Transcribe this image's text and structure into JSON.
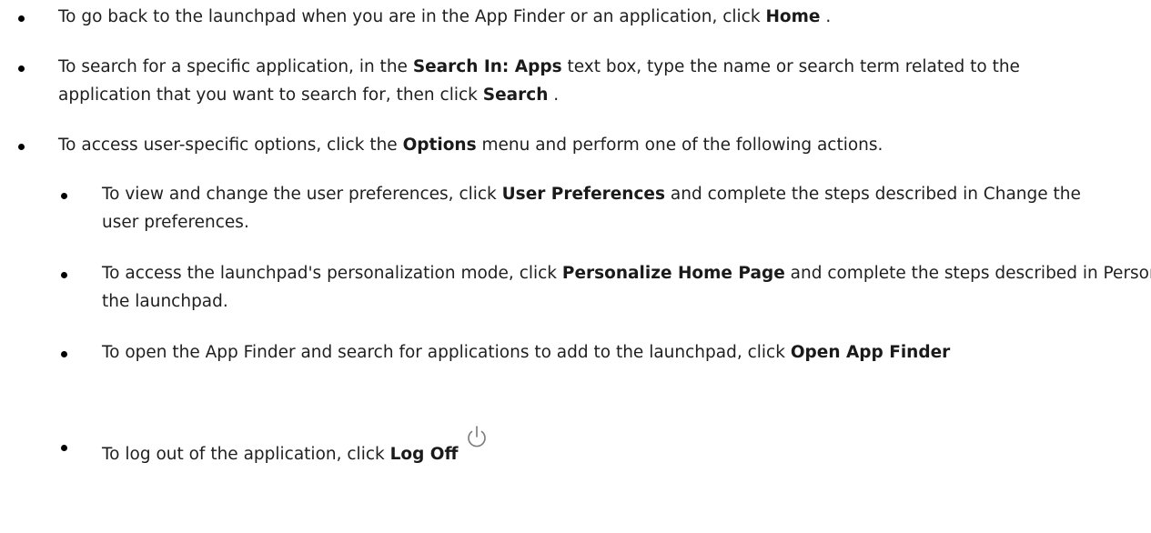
{
  "items": [
    {
      "pre": "To go back to the launchpad when you are in the App Finder or an application, click ",
      "bold": "Home",
      "post": " ."
    },
    {
      "pre": "To search for a specific application, in the ",
      "bold1": "Search In: Apps",
      "mid": " text box, type the name or search term related to the application that you want to search for, then click ",
      "bold2": "Search",
      "post": " ."
    },
    {
      "pre": "To access user-specific options, click the ",
      "bold": "Options",
      "post": " menu and perform one of the following actions."
    }
  ],
  "subitems": [
    {
      "pre": "To view and change the user preferences, click ",
      "bold": "User Preferences",
      "post": " and complete the steps described in Change the user preferences."
    },
    {
      "pre": "To access the launchpad's personalization mode, click ",
      "bold": "Personalize Home Page",
      "post": " and complete the steps described in Personalize the launchpad."
    },
    {
      "pre": "To open the App Finder and search for applications to add to the launchpad, click ",
      "bold": "Open App Finder",
      "post": ""
    },
    {
      "pre": "To log out of the application, click ",
      "bold": "Log Off",
      "post": ""
    }
  ],
  "icons": {
    "log_off": "power-icon"
  }
}
